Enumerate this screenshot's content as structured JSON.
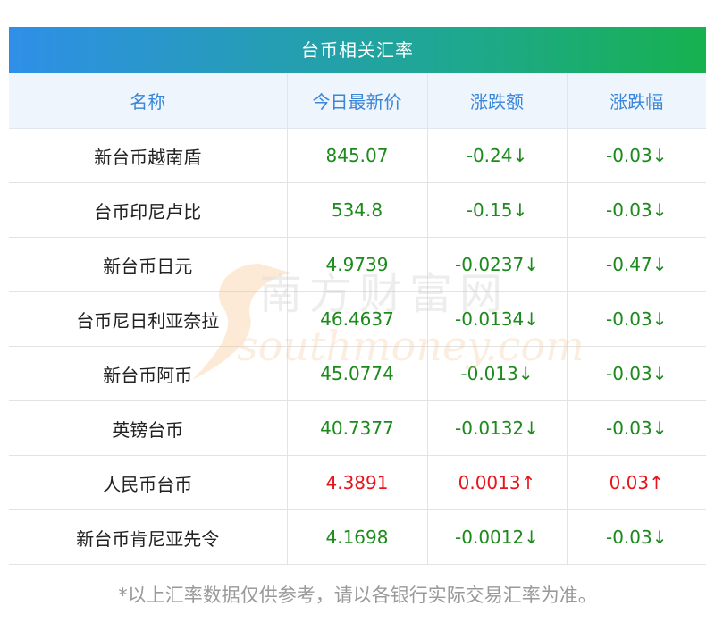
{
  "table": {
    "title": "台币相关汇率",
    "headers": [
      "名称",
      "今日最新价",
      "涨跌额",
      "涨跌幅"
    ],
    "rows": [
      {
        "name": "新台币越南盾",
        "price": "845.07",
        "change": "-0.24↓",
        "pct": "-0.03↓",
        "direction": "down"
      },
      {
        "name": "台币印尼卢比",
        "price": "534.8",
        "change": "-0.15↓",
        "pct": "-0.03↓",
        "direction": "down"
      },
      {
        "name": "新台币日元",
        "price": "4.9739",
        "change": "-0.0237↓",
        "pct": "-0.47↓",
        "direction": "down"
      },
      {
        "name": "台币尼日利亚奈拉",
        "price": "46.4637",
        "change": "-0.0134↓",
        "pct": "-0.03↓",
        "direction": "down"
      },
      {
        "name": "新台币阿币",
        "price": "45.0774",
        "change": "-0.013↓",
        "pct": "-0.03↓",
        "direction": "down"
      },
      {
        "name": "英镑台币",
        "price": "40.7377",
        "change": "-0.0132↓",
        "pct": "-0.03↓",
        "direction": "down"
      },
      {
        "name": "人民币台币",
        "price": "4.3891",
        "change": "0.0013↑",
        "pct": "0.03↑",
        "direction": "up"
      },
      {
        "name": "新台币肯尼亚先令",
        "price": "4.1698",
        "change": "-0.0012↓",
        "pct": "-0.03↓",
        "direction": "down"
      }
    ]
  },
  "watermark": {
    "cn": "南方财富网",
    "en": "southmoney.com"
  },
  "footnote": "*以上汇率数据仅供参考，请以各银行实际交易汇率为准。",
  "colors": {
    "down": "#1c8a1c",
    "up": "#e8131b",
    "header_text": "#3a86d9"
  }
}
